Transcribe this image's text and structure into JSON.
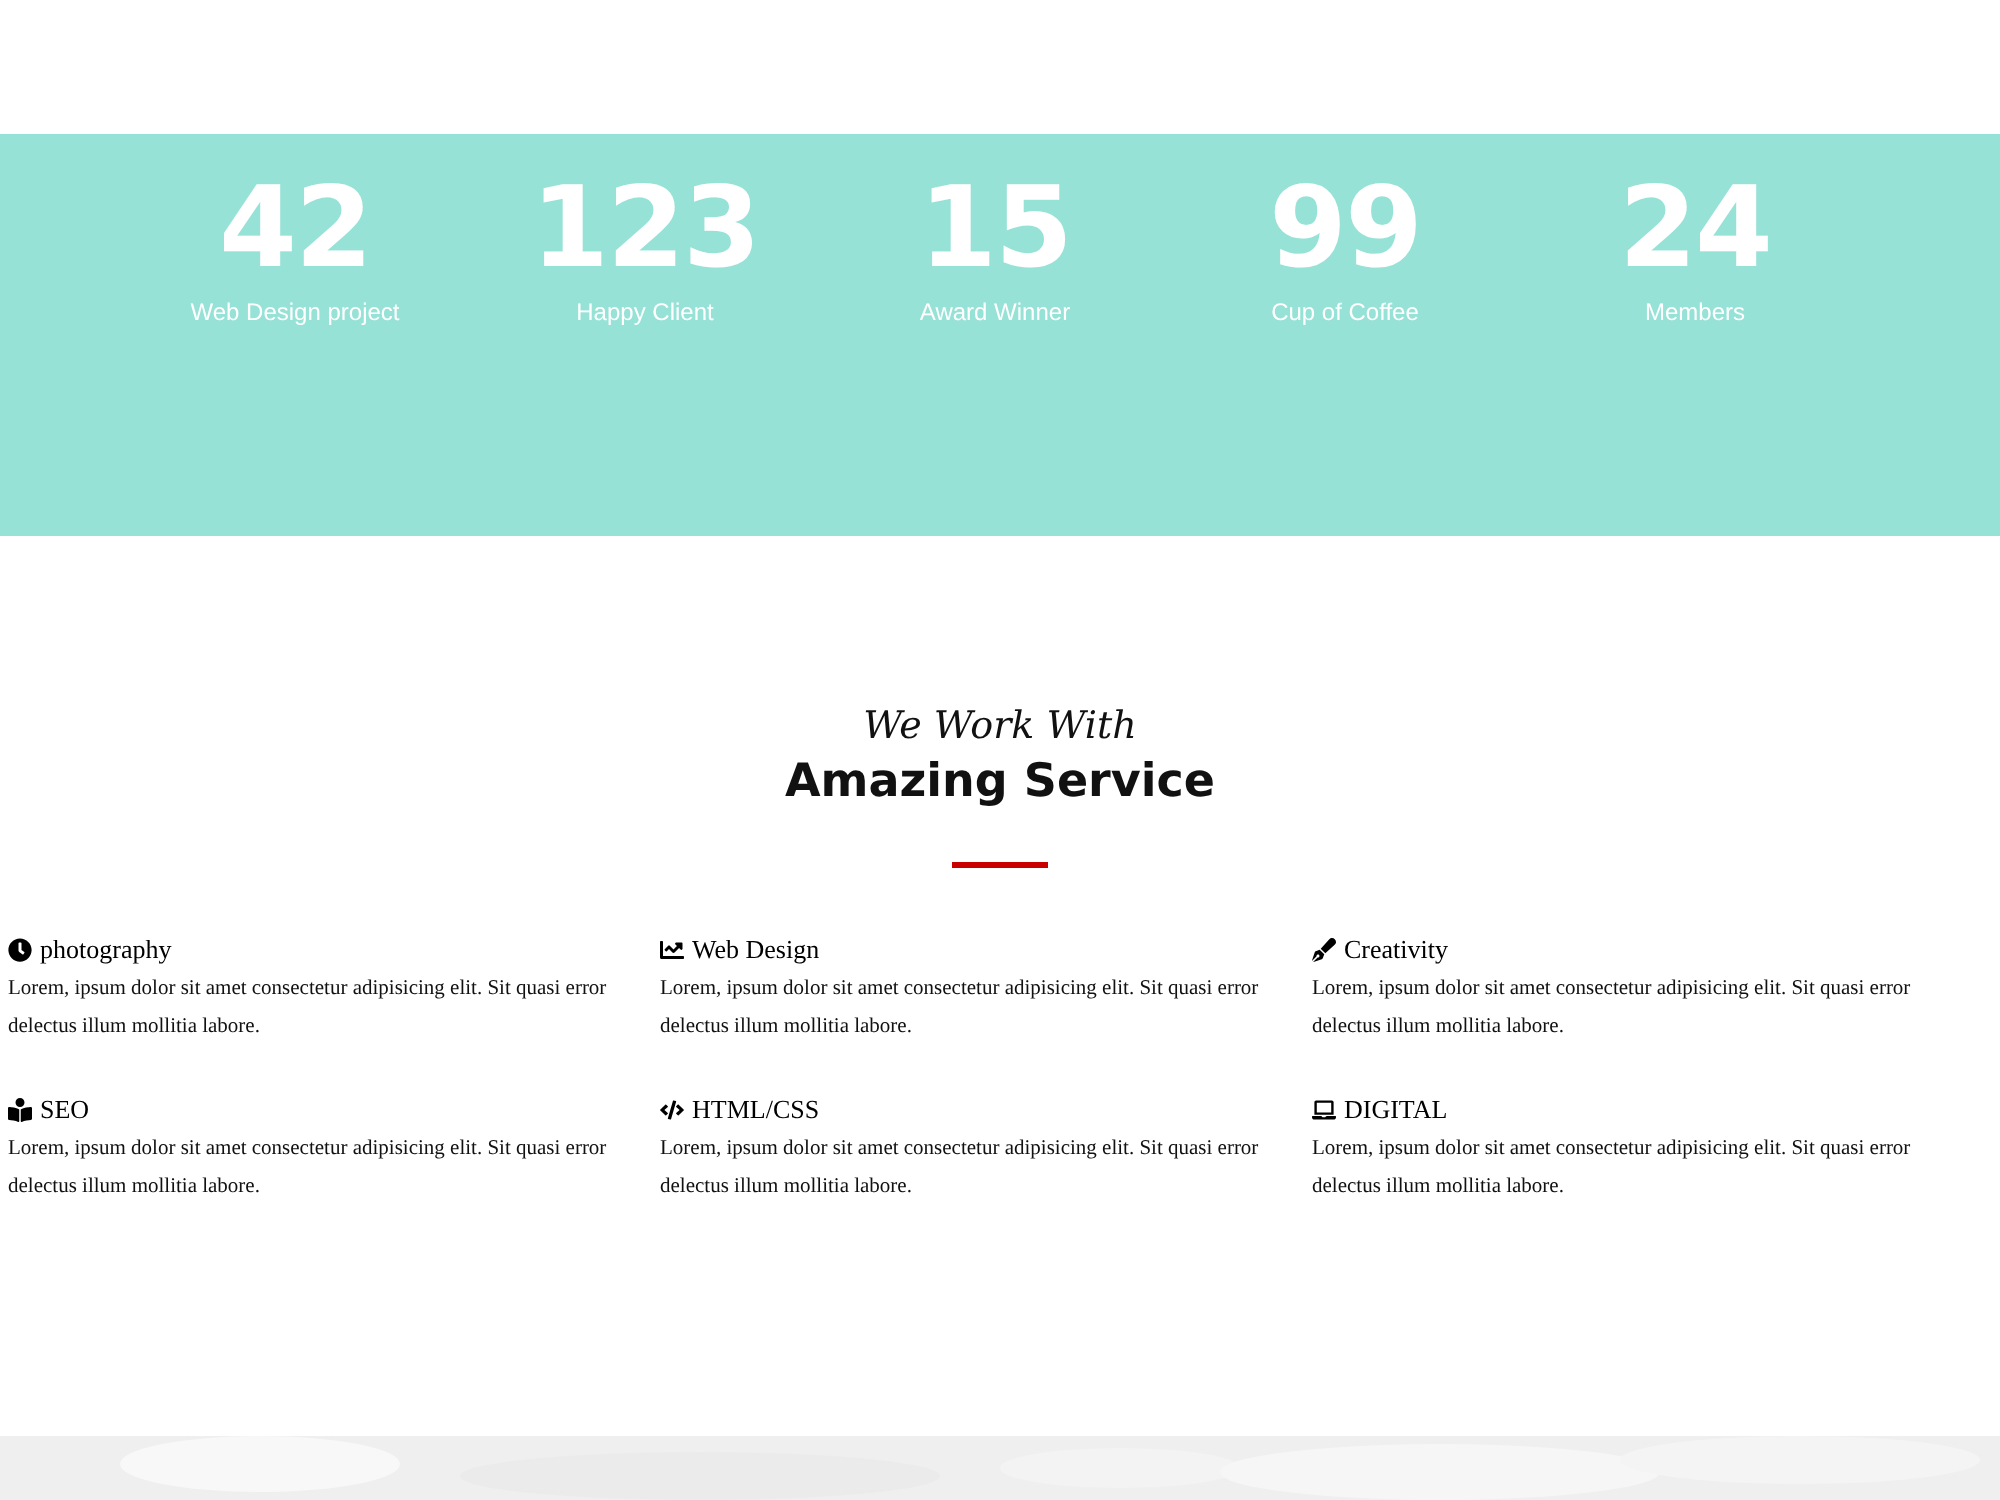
{
  "stats": [
    {
      "number": "42",
      "label": "Web Design project"
    },
    {
      "number": "123",
      "label": "Happy Client"
    },
    {
      "number": "15",
      "label": "Award Winner"
    },
    {
      "number": "99",
      "label": "Cup of Coffee"
    },
    {
      "number": "24",
      "label": "Members"
    }
  ],
  "services_heading": {
    "kicker": "We Work With",
    "title": "Amazing Service"
  },
  "services": [
    {
      "kind": "clock",
      "title": "photography",
      "text": "Lorem, ipsum dolor sit amet consectetur adipisicing elit. Sit quasi error delectus illum mollitia labore."
    },
    {
      "kind": "chart",
      "title": "Web Design",
      "text": "Lorem, ipsum dolor sit amet consectetur adipisicing elit. Sit quasi error delectus illum mollitia labore."
    },
    {
      "kind": "pen",
      "title": "Creativity",
      "text": "Lorem, ipsum dolor sit amet consectetur adipisicing elit. Sit quasi error delectus illum mollitia labore."
    },
    {
      "kind": "reader",
      "title": "SEO",
      "text": "Lorem, ipsum dolor sit amet consectetur adipisicing elit. Sit quasi error delectus illum mollitia labore."
    },
    {
      "kind": "code",
      "title": "HTML/CSS",
      "text": "Lorem, ipsum dolor sit amet consectetur adipisicing elit. Sit quasi error delectus illum mollitia labore."
    },
    {
      "kind": "laptop",
      "title": "DIGITAL",
      "text": "Lorem, ipsum dolor sit amet consectetur adipisicing elit. Sit quasi error delectus illum mollitia labore."
    }
  ]
}
